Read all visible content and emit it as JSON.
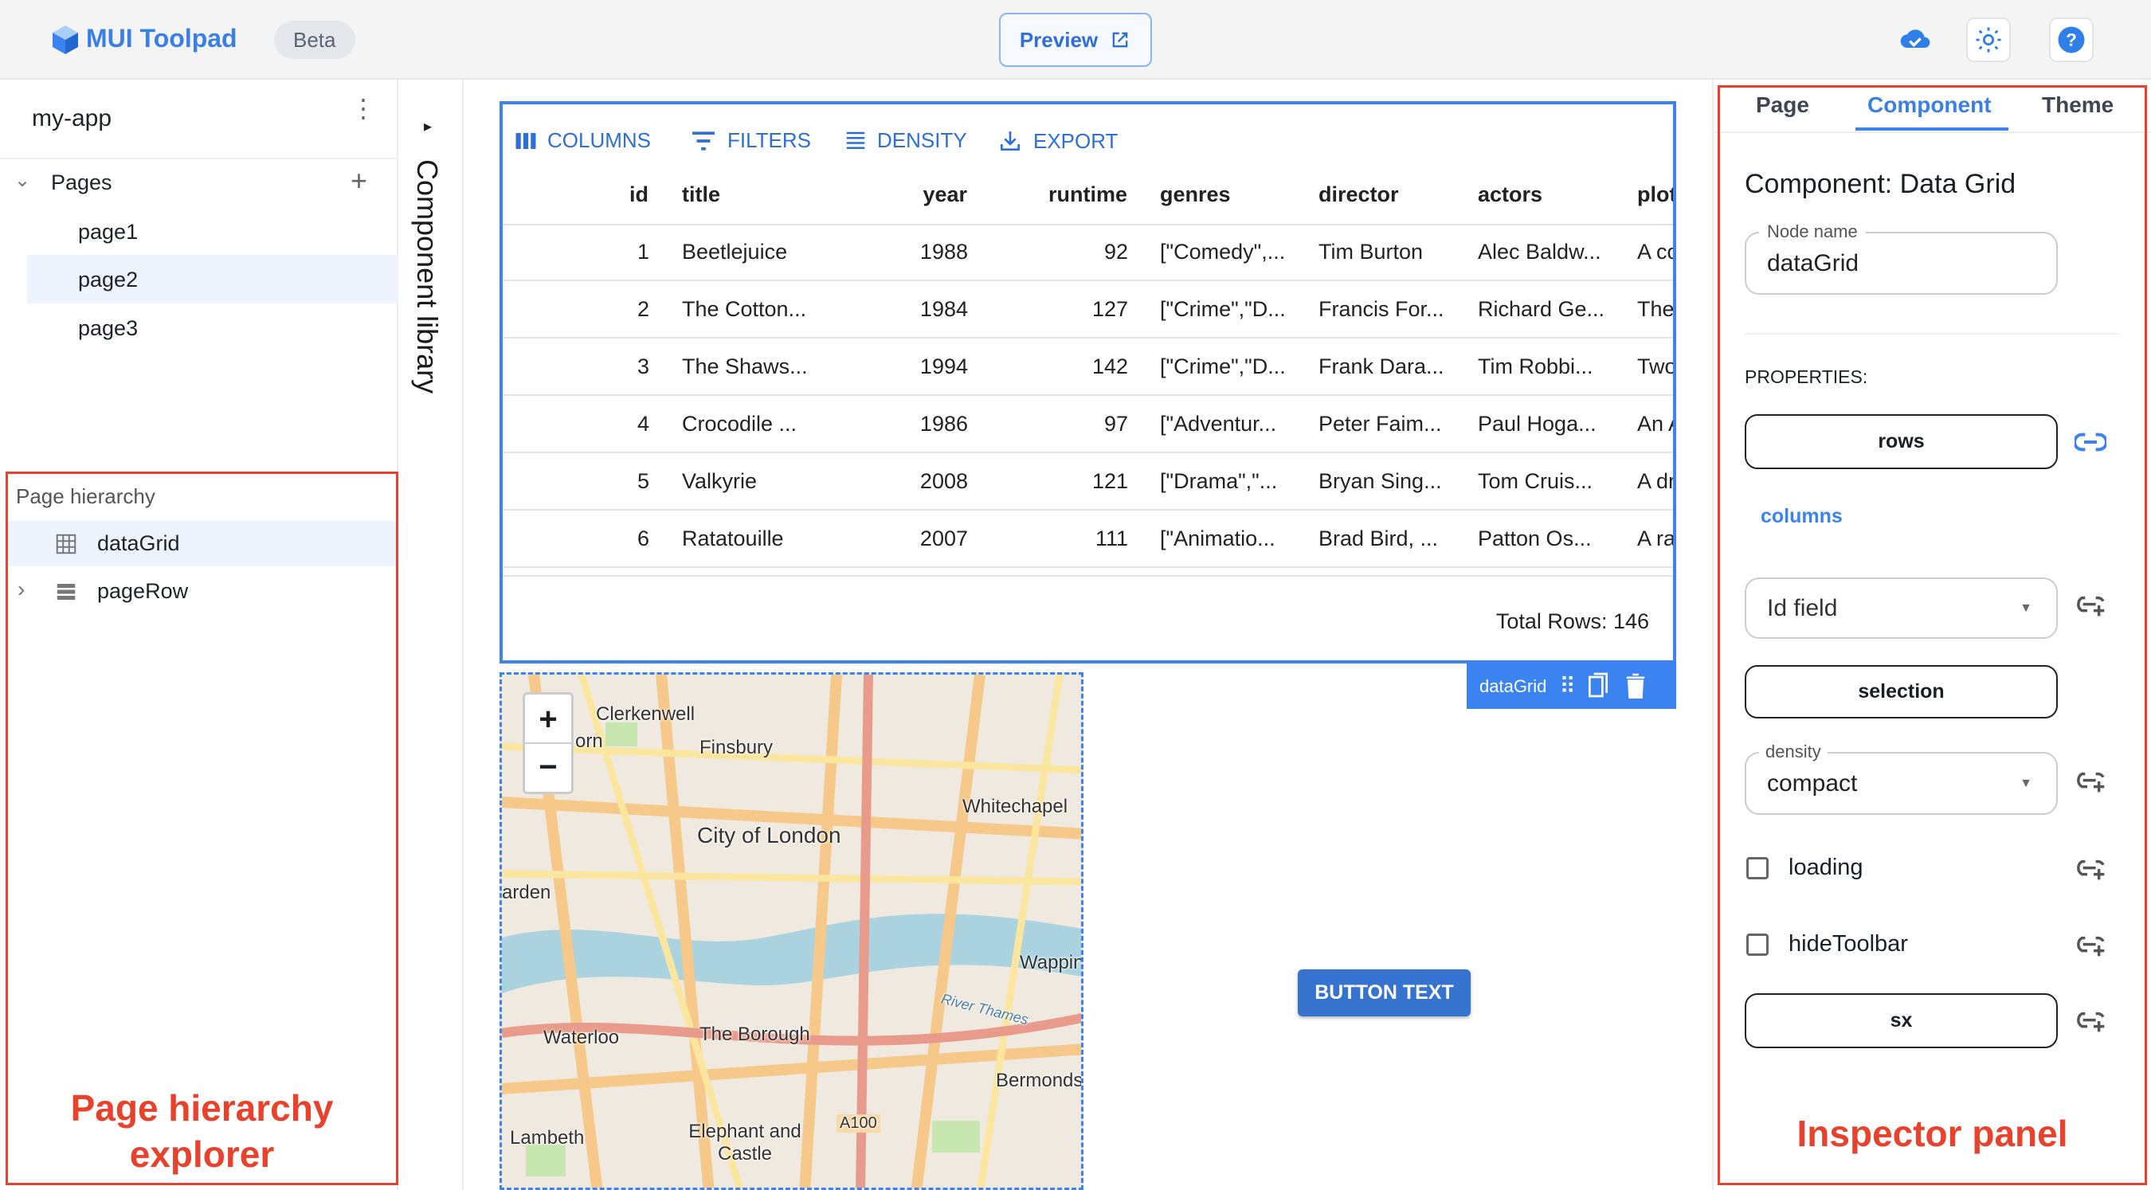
{
  "header": {
    "app_name": "MUI Toolpad",
    "badge": "Beta",
    "preview_label": "Preview",
    "icons": [
      "cloud-done-icon",
      "light-mode-icon",
      "help-icon"
    ],
    "accent": "#3a83f0"
  },
  "sidebar": {
    "app_name": "my-app",
    "pages_label": "Pages",
    "pages": [
      "page1",
      "page2",
      "page3"
    ],
    "selected_page": "page2",
    "hierarchy_title": "Page hierarchy",
    "hierarchy": [
      {
        "label": "dataGrid",
        "icon": "grid-icon"
      },
      {
        "label": "pageRow",
        "icon": "rows-icon"
      }
    ]
  },
  "component_library": {
    "label": "Component library"
  },
  "grid": {
    "toolbar": [
      "COLUMNS",
      "FILTERS",
      "DENSITY",
      "EXPORT"
    ],
    "columns": [
      "id",
      "title",
      "year",
      "runtime",
      "genres",
      "director",
      "actors",
      "plot"
    ],
    "rows": [
      [
        "1",
        "Beetlejuice",
        "1988",
        "92",
        "[\"Comedy\",...",
        "Tim Burton",
        "Alec Baldw...",
        "A co"
      ],
      [
        "2",
        "The Cotton...",
        "1984",
        "127",
        "[\"Crime\",\"D...",
        "Francis For...",
        "Richard Ge...",
        "The"
      ],
      [
        "3",
        "The Shaws...",
        "1994",
        "142",
        "[\"Crime\",\"D...",
        "Frank Dara...",
        "Tim Robbi...",
        "Two"
      ],
      [
        "4",
        "Crocodile ...",
        "1986",
        "97",
        "[\"Adventur...",
        "Peter Faim...",
        "Paul Hoga...",
        "An A"
      ],
      [
        "5",
        "Valkyrie",
        "2008",
        "121",
        "[\"Drama\",\"...",
        "Bryan Sing...",
        "Tom Cruis...",
        "A dr"
      ],
      [
        "6",
        "Ratatouille",
        "2007",
        "111",
        "[\"Animatio...",
        "Brad Bird, ...",
        "Patton Os...",
        "A ra"
      ]
    ],
    "footer": "Total Rows: 146",
    "tag": "dataGrid"
  },
  "map": {
    "zoom_in": "+",
    "zoom_out": "−",
    "labels": [
      "Clerkenwell",
      "Finsbury",
      "Whitechapel",
      "City of London",
      "orn",
      "arden",
      "Wapping",
      "River Thames",
      "The Borough",
      "Waterloo",
      "Bermondse",
      "Lambeth",
      "Elephant and Castle",
      "A100"
    ]
  },
  "button": {
    "label": "BUTTON TEXT"
  },
  "inspector": {
    "tabs": [
      "Page",
      "Component",
      "Theme"
    ],
    "active_tab": "Component",
    "title": "Component: Data Grid",
    "node_name_label": "Node name",
    "node_name": "dataGrid",
    "properties_label": "PROPERTIES:",
    "rows_label": "rows",
    "columns_label": "columns",
    "id_field_placeholder": "Id field",
    "selection_label": "selection",
    "density_label": "density",
    "density_value": "compact",
    "loading_label": "loading",
    "loading_checked": false,
    "hide_toolbar_label": "hideToolbar",
    "hide_toolbar_checked": false,
    "sx_label": "sx"
  },
  "annotations": {
    "left": "Page hierarchy explorer",
    "right": "Inspector panel"
  }
}
